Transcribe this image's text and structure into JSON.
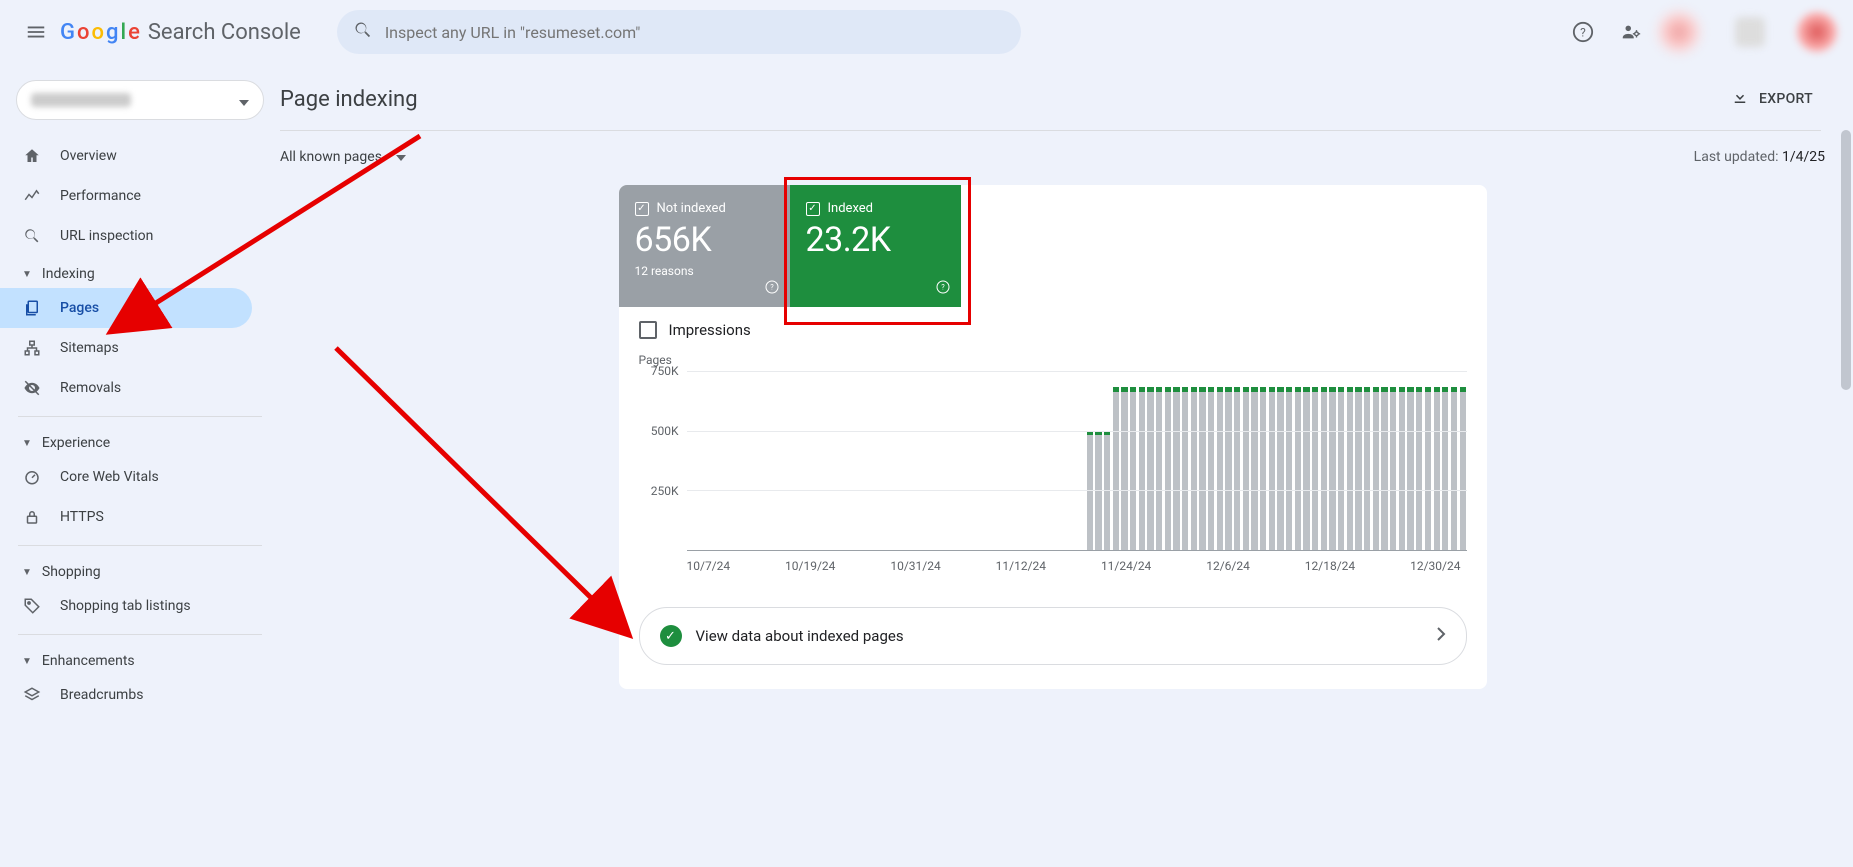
{
  "header": {
    "product": "Search Console",
    "search_placeholder": "Inspect any URL in \"resumeset.com\""
  },
  "sidebar": {
    "items_top": [
      {
        "icon": "home",
        "label": "Overview"
      },
      {
        "icon": "trend",
        "label": "Performance"
      },
      {
        "icon": "search",
        "label": "URL inspection"
      }
    ],
    "indexing": {
      "title": "Indexing",
      "items": [
        {
          "icon": "pages",
          "label": "Pages",
          "active": true
        },
        {
          "icon": "sitemaps",
          "label": "Sitemaps"
        },
        {
          "icon": "removals",
          "label": "Removals"
        }
      ]
    },
    "experience": {
      "title": "Experience",
      "items": [
        {
          "icon": "speed",
          "label": "Core Web Vitals"
        },
        {
          "icon": "lock",
          "label": "HTTPS"
        }
      ]
    },
    "shopping": {
      "title": "Shopping",
      "items": [
        {
          "icon": "tag",
          "label": "Shopping tab listings"
        }
      ]
    },
    "enhancements": {
      "title": "Enhancements",
      "items": [
        {
          "icon": "layers",
          "label": "Breadcrumbs"
        }
      ]
    }
  },
  "page": {
    "title": "Page indexing",
    "export_label": "EXPORT",
    "filter_label": "All known pages",
    "last_updated_prefix": "Last updated: ",
    "last_updated_date": "1/4/25"
  },
  "stats": {
    "not_indexed": {
      "label": "Not indexed",
      "value": "656K",
      "sub": "12 reasons"
    },
    "indexed": {
      "label": "Indexed",
      "value": "23.2K"
    }
  },
  "impressions_label": "Impressions",
  "view_link": "View data about indexed pages",
  "chart_data": {
    "type": "bar",
    "title": "Pages",
    "ylabel": "Pages",
    "ylim": [
      0,
      750000
    ],
    "yticks": [
      "750K",
      "500K",
      "250K"
    ],
    "x_ticks": [
      "10/7/24",
      "10/19/24",
      "10/31/24",
      "11/12/24",
      "11/24/24",
      "12/6/24",
      "12/18/24",
      "12/30/24"
    ],
    "series": [
      {
        "name": "Not indexed",
        "color": "#bdc1c6"
      },
      {
        "name": "Indexed",
        "color": "#1e8e3e"
      }
    ],
    "bars": [
      {
        "ni": 0,
        "i": 0
      },
      {
        "ni": 0,
        "i": 0
      },
      {
        "ni": 0,
        "i": 0
      },
      {
        "ni": 0,
        "i": 0
      },
      {
        "ni": 0,
        "i": 0
      },
      {
        "ni": 0,
        "i": 0
      },
      {
        "ni": 0,
        "i": 0
      },
      {
        "ni": 0,
        "i": 0
      },
      {
        "ni": 0,
        "i": 0
      },
      {
        "ni": 0,
        "i": 0
      },
      {
        "ni": 0,
        "i": 0
      },
      {
        "ni": 0,
        "i": 0
      },
      {
        "ni": 0,
        "i": 0
      },
      {
        "ni": 0,
        "i": 0
      },
      {
        "ni": 0,
        "i": 0
      },
      {
        "ni": 0,
        "i": 0
      },
      {
        "ni": 0,
        "i": 0
      },
      {
        "ni": 0,
        "i": 0
      },
      {
        "ni": 0,
        "i": 0
      },
      {
        "ni": 0,
        "i": 0
      },
      {
        "ni": 0,
        "i": 0
      },
      {
        "ni": 0,
        "i": 0
      },
      {
        "ni": 0,
        "i": 0
      },
      {
        "ni": 0,
        "i": 0
      },
      {
        "ni": 0,
        "i": 0
      },
      {
        "ni": 0,
        "i": 0
      },
      {
        "ni": 0,
        "i": 0
      },
      {
        "ni": 0,
        "i": 0
      },
      {
        "ni": 0,
        "i": 0
      },
      {
        "ni": 0,
        "i": 0
      },
      {
        "ni": 0,
        "i": 0
      },
      {
        "ni": 0,
        "i": 0
      },
      {
        "ni": 0,
        "i": 0
      },
      {
        "ni": 0,
        "i": 0
      },
      {
        "ni": 0,
        "i": 0
      },
      {
        "ni": 0,
        "i": 0
      },
      {
        "ni": 0,
        "i": 0
      },
      {
        "ni": 0,
        "i": 0
      },
      {
        "ni": 0,
        "i": 0
      },
      {
        "ni": 0,
        "i": 0
      },
      {
        "ni": 0,
        "i": 0
      },
      {
        "ni": 0,
        "i": 0
      },
      {
        "ni": 0,
        "i": 0
      },
      {
        "ni": 0,
        "i": 0
      },
      {
        "ni": 0,
        "i": 0
      },
      {
        "ni": 0,
        "i": 0
      },
      {
        "ni": 480000,
        "i": 20000
      },
      {
        "ni": 480000,
        "i": 20000
      },
      {
        "ni": 480000,
        "i": 20000
      },
      {
        "ni": 660000,
        "i": 23000
      },
      {
        "ni": 660000,
        "i": 23000
      },
      {
        "ni": 660000,
        "i": 23000
      },
      {
        "ni": 660000,
        "i": 23000
      },
      {
        "ni": 660000,
        "i": 23000
      },
      {
        "ni": 660000,
        "i": 23000
      },
      {
        "ni": 660000,
        "i": 23000
      },
      {
        "ni": 660000,
        "i": 23000
      },
      {
        "ni": 660000,
        "i": 23000
      },
      {
        "ni": 660000,
        "i": 23000
      },
      {
        "ni": 660000,
        "i": 23000
      },
      {
        "ni": 660000,
        "i": 23000
      },
      {
        "ni": 660000,
        "i": 23000
      },
      {
        "ni": 660000,
        "i": 23000
      },
      {
        "ni": 660000,
        "i": 23000
      },
      {
        "ni": 660000,
        "i": 23000
      },
      {
        "ni": 660000,
        "i": 23000
      },
      {
        "ni": 660000,
        "i": 23000
      },
      {
        "ni": 660000,
        "i": 23000
      },
      {
        "ni": 660000,
        "i": 23000
      },
      {
        "ni": 660000,
        "i": 23000
      },
      {
        "ni": 660000,
        "i": 23000
      },
      {
        "ni": 660000,
        "i": 23000
      },
      {
        "ni": 660000,
        "i": 23000
      },
      {
        "ni": 660000,
        "i": 23000
      },
      {
        "ni": 660000,
        "i": 23000
      },
      {
        "ni": 660000,
        "i": 23000
      },
      {
        "ni": 660000,
        "i": 23000
      },
      {
        "ni": 660000,
        "i": 23000
      },
      {
        "ni": 660000,
        "i": 23000
      },
      {
        "ni": 660000,
        "i": 23000
      },
      {
        "ni": 660000,
        "i": 23000
      },
      {
        "ni": 660000,
        "i": 23000
      },
      {
        "ni": 660000,
        "i": 23000
      },
      {
        "ni": 660000,
        "i": 23000
      },
      {
        "ni": 660000,
        "i": 23000
      },
      {
        "ni": 660000,
        "i": 23000
      },
      {
        "ni": 660000,
        "i": 23000
      },
      {
        "ni": 660000,
        "i": 23000
      },
      {
        "ni": 660000,
        "i": 23000
      },
      {
        "ni": 660000,
        "i": 23000
      }
    ]
  }
}
